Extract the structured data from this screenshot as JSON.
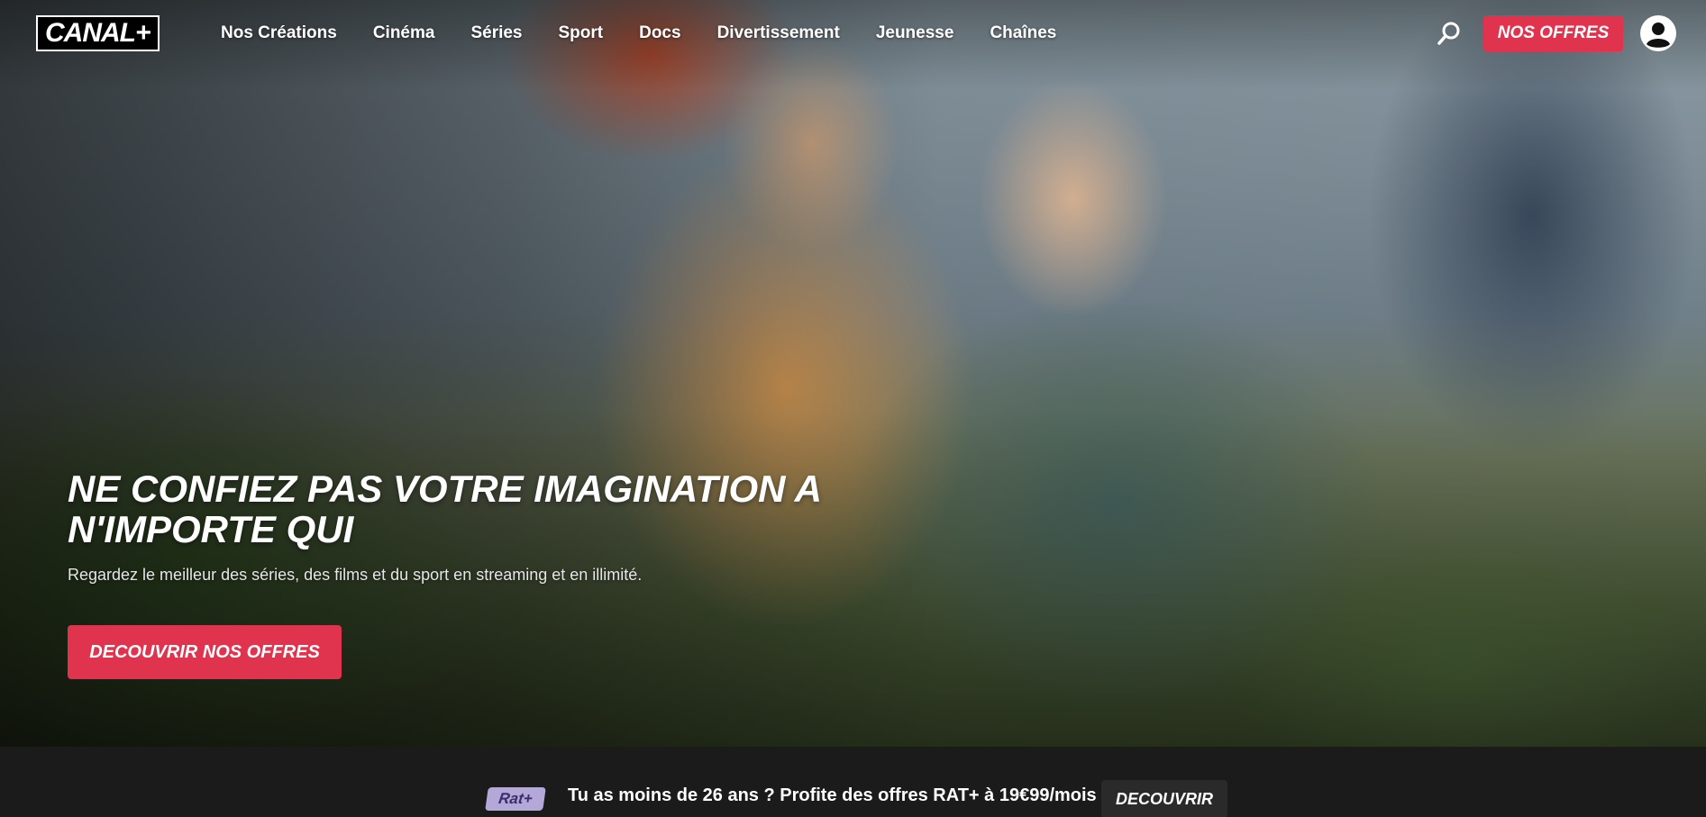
{
  "brand": {
    "logo_text": "CANAL+"
  },
  "nav": {
    "items": [
      {
        "label": "Nos Créations"
      },
      {
        "label": "Cinéma"
      },
      {
        "label": "Séries"
      },
      {
        "label": "Sport"
      },
      {
        "label": "Docs"
      },
      {
        "label": "Divertissement"
      },
      {
        "label": "Jeunesse"
      },
      {
        "label": "Chaînes"
      }
    ]
  },
  "header": {
    "search_icon": "search-icon",
    "offers_label": "NOS OFFRES",
    "account_icon": "user-account-icon"
  },
  "hero": {
    "headline": "NE CONFIEZ PAS VOTRE IMAGINATION A N'IMPORTE QUI",
    "subline": "Regardez le meilleur des séries, des films et du sport en streaming et en illimité.",
    "cta_label": "DECOUVRIR NOS OFFRES"
  },
  "banner": {
    "badge": "Rat+",
    "text": "Tu as moins de 26 ans ? Profite des offres RAT+ à 19€99/mois",
    "button_label": "DECOUVRIR"
  },
  "colors": {
    "accent": "#e0334d",
    "banner_bg": "#1b1b1b",
    "badge_bg": "#b4a8d9"
  }
}
